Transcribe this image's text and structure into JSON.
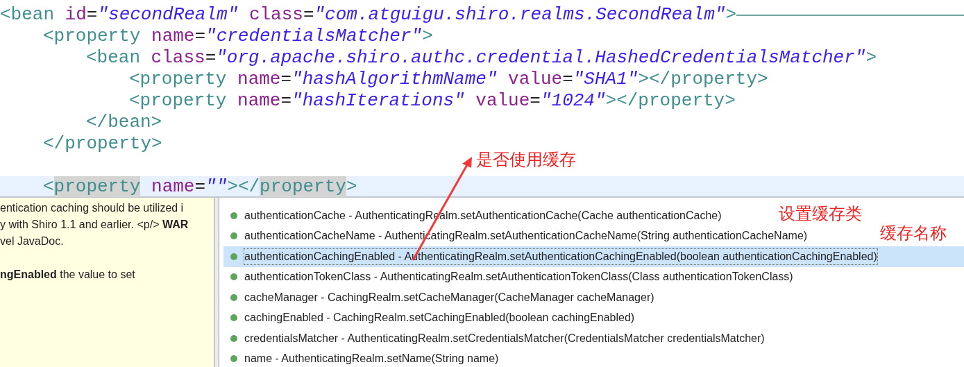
{
  "editor": {
    "lines": [
      {
        "tokens": [
          {
            "kind": "tag",
            "text": "<bean"
          },
          {
            "kind": "attr",
            "text": " id"
          },
          {
            "kind": "eq",
            "text": "="
          },
          {
            "kind": "value",
            "text": "\"secondRealm\""
          },
          {
            "kind": "attr",
            "text": " class"
          },
          {
            "kind": "eq",
            "text": "="
          },
          {
            "kind": "value",
            "text": "\"com.atguigu.shiro.realms.SecondRealm\""
          },
          {
            "kind": "tag",
            "text": ">"
          }
        ],
        "current": false,
        "children": [
          {
            "tokens": [
              {
                "kind": "tag",
                "text": "<property"
              },
              {
                "kind": "attr",
                "text": " name"
              },
              {
                "kind": "eq",
                "text": "="
              },
              {
                "kind": "value",
                "text": "\"credentialsMatcher\""
              },
              {
                "kind": "tag",
                "text": ">"
              }
            ],
            "current": false,
            "children": [
              {
                "tokens": [
                  {
                    "kind": "tag",
                    "text": "<bean"
                  },
                  {
                    "kind": "attr",
                    "text": " class"
                  },
                  {
                    "kind": "eq",
                    "text": "="
                  },
                  {
                    "kind": "value",
                    "text": "\"org.apache.shiro.authc.credential.HashedCredentialsMatcher\""
                  },
                  {
                    "kind": "tag",
                    "text": ">"
                  }
                ],
                "current": false,
                "children": [
                  {
                    "tokens": [
                      {
                        "kind": "tag",
                        "text": "<property"
                      },
                      {
                        "kind": "attr",
                        "text": " name"
                      },
                      {
                        "kind": "eq",
                        "text": "="
                      },
                      {
                        "kind": "value",
                        "text": "\"hashAlgorithmName\""
                      },
                      {
                        "kind": "attr",
                        "text": " value"
                      },
                      {
                        "kind": "eq",
                        "text": "="
                      },
                      {
                        "kind": "value",
                        "text": "\"SHA1\""
                      },
                      {
                        "kind": "tag",
                        "text": "></property>"
                      }
                    ],
                    "current": false
                  },
                  {
                    "tokens": [
                      {
                        "kind": "tag",
                        "text": "<property"
                      },
                      {
                        "kind": "attr",
                        "text": " name"
                      },
                      {
                        "kind": "eq",
                        "text": "="
                      },
                      {
                        "kind": "value",
                        "text": "\"hashIterations\""
                      },
                      {
                        "kind": "attr",
                        "text": " value"
                      },
                      {
                        "kind": "eq",
                        "text": "="
                      },
                      {
                        "kind": "value",
                        "text": "\"1024\""
                      },
                      {
                        "kind": "tag",
                        "text": "></property>"
                      }
                    ],
                    "current": false
                  }
                ]
              },
              {
                "tokens": [
                  {
                    "kind": "tag",
                    "text": "</bean>"
                  }
                ],
                "current": false
              }
            ]
          },
          {
            "tokens": [
              {
                "kind": "tag",
                "text": "</property>"
              }
            ],
            "current": false
          },
          {
            "current": false
          },
          {
            "tokens": [
              {
                "kind": "tag",
                "text": "<"
              },
              {
                "kind": "tag",
                "text": "property",
                "marked": true
              },
              {
                "kind": "attr",
                "text": " name"
              },
              {
                "kind": "eq",
                "text": "="
              },
              {
                "kind": "value",
                "text": "\"\""
              },
              {
                "kind": "tag",
                "text": "></"
              },
              {
                "kind": "tag",
                "text": "property",
                "marked": true
              },
              {
                "kind": "tag",
                "text": ">"
              }
            ],
            "current": true
          }
        ]
      }
    ]
  },
  "javadoc_tooltip": {
    "lines": [
      "entication caching should be utilized i",
      "y with Shiro 1.1 and earlier. <p/> **WAR**",
      "vel JavaDoc.",
      "**ngEnabled** the value to set"
    ]
  },
  "proposals": [
    {
      "text": "authenticationCache - AuthenticatingRealm.setAuthenticationCache(Cache authenticationCache)",
      "selected": false
    },
    {
      "text": "authenticationCacheName - AuthenticatingRealm.setAuthenticationCacheName(String authenticationCacheName)",
      "selected": false
    },
    {
      "text": "authenticationCachingEnabled - AuthenticatingRealm.setAuthenticationCachingEnabled(boolean authenticationCachingEnabled)",
      "selected": true
    },
    {
      "text": "authenticationTokenClass - AuthenticatingRealm.setAuthenticationTokenClass(Class authenticationTokenClass)",
      "selected": false
    },
    {
      "text": "cacheManager - CachingRealm.setCacheManager(CacheManager cacheManager)",
      "selected": false
    },
    {
      "text": "cachingEnabled - CachingRealm.setCachingEnabled(boolean cachingEnabled)",
      "selected": false
    },
    {
      "text": "credentialsMatcher - AuthenticatingRealm.setCredentialsMatcher(CredentialsMatcher credentialsMatcher)",
      "selected": false
    },
    {
      "text": "name - AuthenticatingRealm.setName(String name)",
      "selected": false
    }
  ],
  "annotations": [
    "是否使用缓存",
    "设置缓存类",
    "缓存名称"
  ]
}
